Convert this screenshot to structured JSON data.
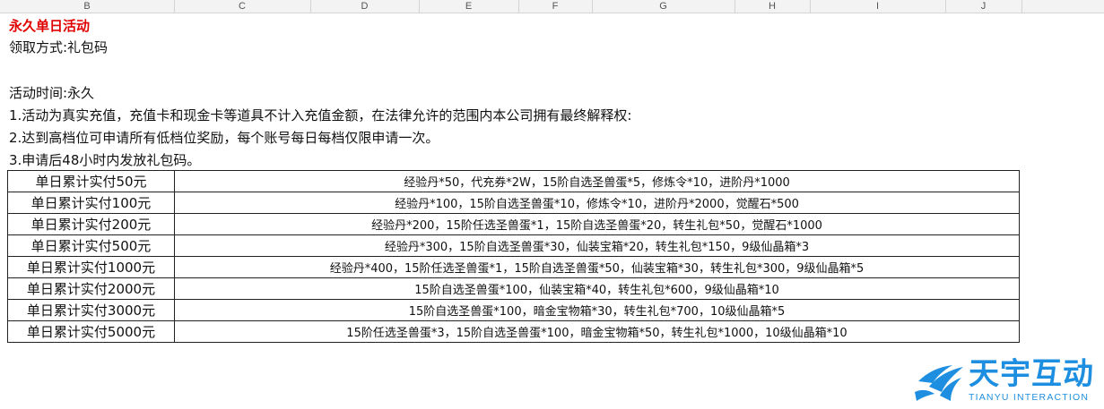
{
  "columns": [
    "B",
    "C",
    "D",
    "E",
    "F",
    "G",
    "H",
    "I",
    "J"
  ],
  "sheet": {
    "title": "永久单日活动",
    "claim_method": "领取方式:礼包码",
    "activity_time": "活动时间:永久",
    "rule_1": "1.活动为真实充值，充值卡和现金卡等道具不计入充值金额，在法律允许的范围内本公司拥有最终解释权:",
    "rule_2": "2.达到高档位可申请所有低档位奖励，每个账号每日每档仅限申请一次。",
    "rule_3": "3.申请后48小时内发放礼包码。"
  },
  "rows": [
    {
      "tier": "单日累计实付50元",
      "reward": "经验丹*50，代充券*2W，15阶自选圣兽蛋*5，修炼令*10，进阶丹*1000"
    },
    {
      "tier": "单日累计实付100元",
      "reward": "经验丹*100，15阶自选圣兽蛋*10，修炼令*10，进阶丹*2000，觉醒石*500"
    },
    {
      "tier": "单日累计实付200元",
      "reward": "经验丹*200，15阶任选圣兽蛋*1，15阶自选圣兽蛋*20，转生礼包*50，觉醒石*1000"
    },
    {
      "tier": "单日累计实付500元",
      "reward": "经验丹*300，15阶自选圣兽蛋*30，仙装宝箱*20，转生礼包*150，9级仙晶箱*3"
    },
    {
      "tier": "单日累计实付1000元",
      "reward": "经验丹*400，15阶任选圣兽蛋*1，15阶自选圣兽蛋*50，仙装宝箱*30，转生礼包*300，9级仙晶箱*5"
    },
    {
      "tier": "单日累计实付2000元",
      "reward": "15阶自选圣兽蛋*100，仙装宝箱*40，转生礼包*600，9级仙晶箱*10"
    },
    {
      "tier": "单日累计实付3000元",
      "reward": "15阶自选圣兽蛋*100，暗金宝物箱*30，转生礼包*700，10级仙晶箱*5"
    },
    {
      "tier": "单日累计实付5000元",
      "reward": "15阶任选圣兽蛋*3，15阶自选圣兽蛋*100，暗金宝物箱*50，转生礼包*1000，10级仙晶箱*10"
    }
  ],
  "logo": {
    "name_cn": "天宇互动",
    "name_en": "TIANYU INTERACTION",
    "icon": "tianyu-logo-icon",
    "color": "#1e8fe0"
  },
  "colors": {
    "title": "#e00000"
  }
}
